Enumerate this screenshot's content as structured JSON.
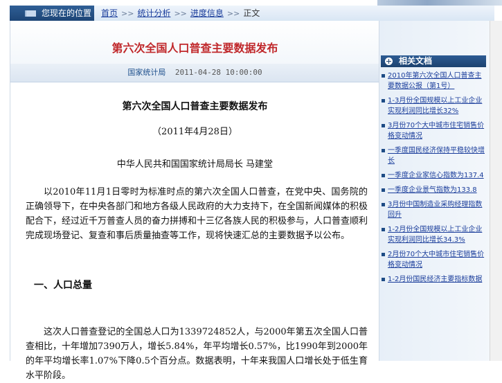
{
  "breadcrumb": {
    "label": "您现在的位置",
    "items": [
      "首页",
      "统计分析",
      "进度信息",
      "正文"
    ],
    "separator": ">>"
  },
  "article": {
    "page_title": "第六次全国人口普查主要数据发布",
    "source": "国家统计局",
    "publish_time": "2011-04-28 10:00:00",
    "title": "第六次全国人口普查主要数据发布",
    "date": "（2011年4月28日）",
    "author": "中华人民共和国国家统计局局长 马建堂",
    "paragraph1": "以2010年11月1日零时为标准时点的第六次全国人口普查，在党中央、国务院的正确领导下，在中央各部门和地方各级人民政府的大力支持下，在全国新闻媒体的积极配合下，经过近千万普查人员的奋力拼搏和十三亿各族人民的积极参与，人口普查顺利完成现场登记、复查和事后质量抽查等工作，现将快速汇总的主要数据予以公布。",
    "section1_heading": "一、人口总量",
    "paragraph2": "这次人口普查登记的全国总人口为1339724852人，与2000年第五次全国人口普查相比，十年增加7390万人，增长5.84%，年平均增长0.57%，比1990年到2000年的年平均增长率1.07%下降0.5个百分点。数据表明，十年来我国人口增长处于低生育水平阶段。"
  },
  "sidebar": {
    "title": "相关文档",
    "items": [
      "2010年第六次全国人口普查主要数据公报（第1号）",
      "1-3月份全国规模以上工业企业实现利润同比增长32%",
      "3月份70个大中城市住宅销售价格变动情况",
      "一季度国民经济保持平稳较快增长",
      "一季度企业家信心指数为137.4",
      "一季度企业景气指数为133.8",
      "3月份中国制造业采购经理指数回升",
      "1-2月份全国规模以上工业企业实现利润同比增长34.3%",
      "2月份70个大中城市住宅销售价格变动情况",
      "1-2月份国民经济主要指标数据"
    ]
  },
  "colors": {
    "title_red": "#c0282b",
    "link_blue": "#1a3d9b",
    "header_navy": "#1c426f"
  }
}
